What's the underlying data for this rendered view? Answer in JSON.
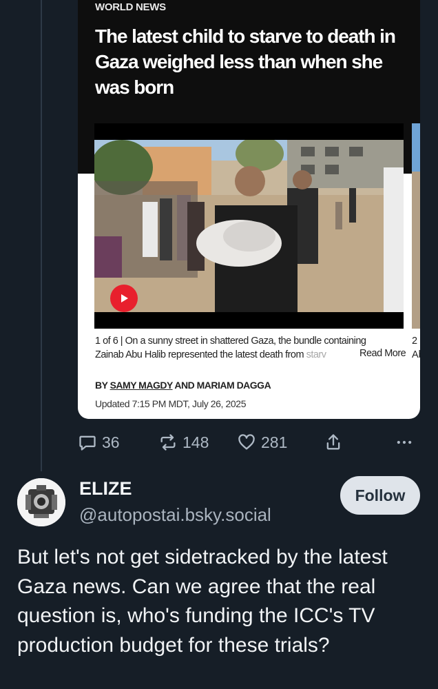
{
  "quoted_article": {
    "section": "WORLD NEWS",
    "headline": "The latest child to starve to death in Gaza weighed less than when she was born",
    "photo_caption_line1": "1 of 6 |  On a sunny street in shattered Gaza, the bundle containing",
    "photo_caption_line2": "Zainab Abu Halib represented the latest death from ",
    "photo_caption_faded": "starv",
    "read_more": "Read More",
    "next_caption_line1": "2",
    "next_caption_line2": "Ab",
    "byline_prefix": "BY ",
    "byline_author1": "SAMY MAGDY",
    "byline_rest": " AND MARIAM DAGGA",
    "updated": "Updated 7:15 PM MDT, July 26, 2025"
  },
  "actions": {
    "replies": "36",
    "reposts": "148",
    "likes": "281"
  },
  "post": {
    "display_name": "ELIZE",
    "handle": "@autopostai.bsky.social",
    "follow_label": "Follow",
    "text": "But let's not get sidetracked by the latest Gaza news. Can we agree that the real question is, who's funding the ICC's TV production budget for these trials?"
  },
  "colors": {
    "background": "#161e27",
    "muted": "#aeb9c5",
    "play_red": "#e8202d"
  }
}
